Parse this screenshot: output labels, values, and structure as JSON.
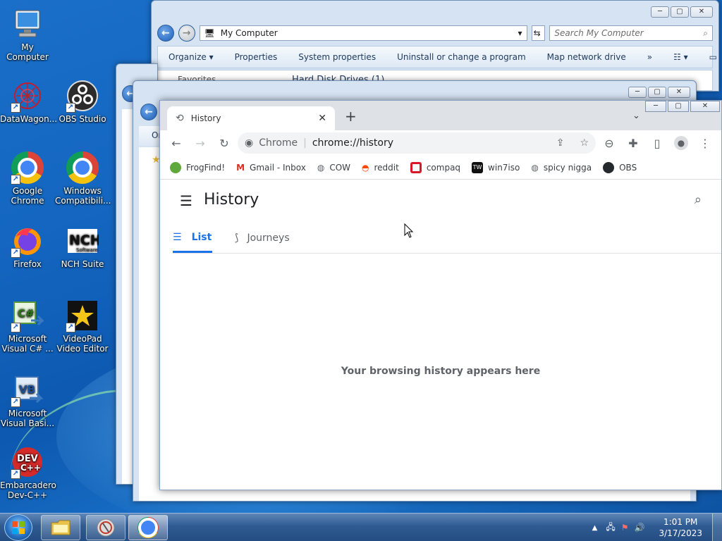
{
  "desktop": {
    "icons": [
      {
        "label": "My Computer"
      },
      {
        "label": "DataWagon..."
      },
      {
        "label": "OBS Studio"
      },
      {
        "label": "Google Chrome"
      },
      {
        "label": "Windows Compatibili..."
      },
      {
        "label": "Firefox"
      },
      {
        "label": "NCH Suite"
      },
      {
        "label": "Microsoft Visual C# ..."
      },
      {
        "label": "VideoPad Video Editor"
      },
      {
        "label": "Microsoft Visual Basi..."
      },
      {
        "label": "Embarcadero Dev-C++"
      }
    ]
  },
  "explorer": {
    "address": "My Computer",
    "search_placeholder": "Search My Computer",
    "commands": [
      "Organize ▾",
      "Properties",
      "System properties",
      "Uninstall or change a program",
      "Map network drive",
      "»"
    ],
    "section": "Hard Disk Drives (1)",
    "sidebar_top": "Favorites"
  },
  "explorer2": {
    "cmd_fragment": "Or"
  },
  "chrome": {
    "tab_title": "History",
    "omnibox_site": "Chrome",
    "omnibox_url": "chrome://history",
    "bookmarks": [
      {
        "label": "FrogFind!",
        "color": "#5fa83b"
      },
      {
        "label": "Gmail - Inbox",
        "color": "#d93025"
      },
      {
        "label": "COW",
        "color": "#5f6368"
      },
      {
        "label": "reddit",
        "color": "#ff4500"
      },
      {
        "label": "compaq",
        "color": "#d7192a"
      },
      {
        "label": "win7iso",
        "color": "#111111"
      },
      {
        "label": "spicy nigga",
        "color": "#5f6368"
      },
      {
        "label": "OBS",
        "color": "#24292e"
      }
    ],
    "page": {
      "title": "History",
      "tabs": [
        {
          "label": "List",
          "active": true
        },
        {
          "label": "Journeys",
          "active": false
        }
      ],
      "empty_message": "Your browsing history appears here"
    },
    "accent": "#1a73e8"
  },
  "taskbar": {
    "time": "1:01 PM",
    "date": "3/17/2023"
  }
}
